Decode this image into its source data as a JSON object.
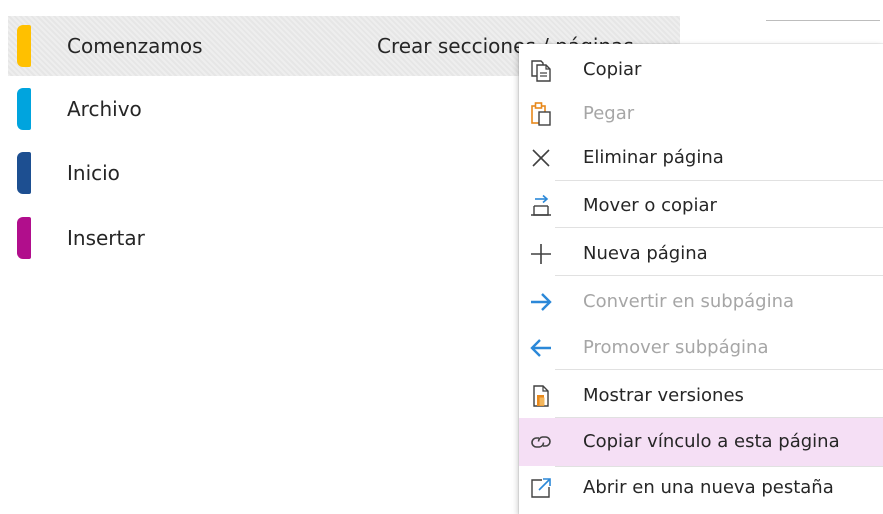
{
  "sections": {
    "items": [
      {
        "label": "Comenzamos",
        "color": "#FFC000",
        "selected": true
      },
      {
        "label": "Archivo",
        "color": "#00A4DE"
      },
      {
        "label": "Inicio",
        "color": "#1D4F91"
      },
      {
        "label": "Insertar",
        "color": "#B10E8C"
      }
    ]
  },
  "pages": {
    "items": [
      {
        "label": "Crear secciones / páginas",
        "selected": true
      }
    ]
  },
  "context_menu": {
    "items": [
      {
        "label": "Copiar",
        "icon": "copy-icon",
        "enabled": true
      },
      {
        "label": "Pegar",
        "icon": "paste-icon",
        "enabled": false
      },
      {
        "label": "Eliminar página",
        "icon": "close-icon",
        "enabled": true
      },
      {
        "label": "Mover o copiar",
        "icon": "move-icon",
        "enabled": true
      },
      {
        "label": "Nueva página",
        "icon": "plus-icon",
        "enabled": true
      },
      {
        "label": "Convertir en subpágina",
        "icon": "arrow-right-icon",
        "enabled": false
      },
      {
        "label": "Promover subpágina",
        "icon": "arrow-left-icon",
        "enabled": false
      },
      {
        "label": "Mostrar versiones",
        "icon": "versions-icon",
        "enabled": true
      },
      {
        "label": "Copiar vínculo a esta página",
        "icon": "link-icon",
        "enabled": true,
        "highlighted": true
      },
      {
        "label": "Abrir en una nueva pestaña",
        "icon": "open-new-tab-icon",
        "enabled": true
      }
    ]
  },
  "colors": {
    "selected_bg": "#EAEAEA",
    "menu_highlight": "#F5DFF5",
    "accent_blue": "#2B88D8",
    "accent_orange": "#E8891C"
  }
}
